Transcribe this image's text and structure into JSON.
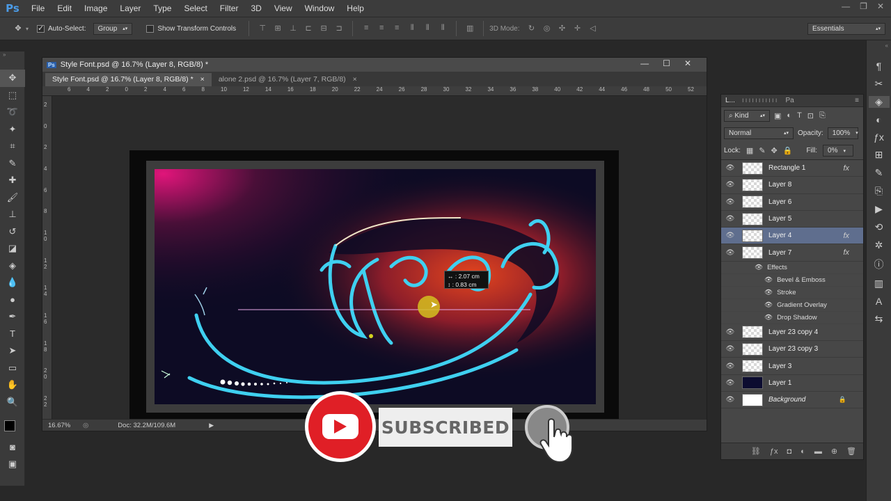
{
  "app": {
    "logo": "Ps"
  },
  "menu": [
    "File",
    "Edit",
    "Image",
    "Layer",
    "Type",
    "Select",
    "Filter",
    "3D",
    "View",
    "Window",
    "Help"
  ],
  "options": {
    "auto_select": "Auto-Select:",
    "group": "Group",
    "transform_controls": "Show Transform Controls",
    "mode_3d": "3D Mode:",
    "workspace": "Essentials"
  },
  "document": {
    "title": "Style Font.psd @ 16.7% (Layer 8, RGB/8) *",
    "tabs": [
      {
        "label": "Style Font.psd @ 16.7% (Layer 8, RGB/8) *",
        "close": "×"
      },
      {
        "label": "alone 2.psd @ 16.7% (Layer 7, RGB/8)",
        "close": "×"
      }
    ],
    "ruler_top": [
      "6",
      "4",
      "2",
      "0",
      "2",
      "4",
      "6",
      "8",
      "10",
      "12",
      "14",
      "16",
      "18",
      "20",
      "22",
      "24",
      "26",
      "28",
      "30",
      "32",
      "34",
      "36",
      "38",
      "40",
      "42",
      "44",
      "46",
      "48",
      "50",
      "52"
    ],
    "ruler_left": [
      "2",
      "0",
      "2",
      "4",
      "6",
      "8",
      "1 0",
      "1 2",
      "1 4",
      "1 6",
      "1 8",
      "2 0",
      "2 2"
    ],
    "zoom": "16.67%",
    "doc_size": "Doc: 32.2M/109.6M",
    "measure_w": "2.07 cm",
    "measure_h": "0.83 cm"
  },
  "layers_panel": {
    "tab": "L...",
    "tab2": "Pa",
    "kind": "Kind",
    "blend": "Normal",
    "opacity_label": "Opacity:",
    "opacity": "100%",
    "lock_label": "Lock:",
    "fill_label": "Fill:",
    "fill": "0%",
    "fx": "fx",
    "layers": [
      {
        "name": "Rectangle 1",
        "fx": true
      },
      {
        "name": "Layer 8"
      },
      {
        "name": "Layer 6"
      },
      {
        "name": "Layer 5"
      },
      {
        "name": "Layer 4",
        "fx": true,
        "selected": true
      },
      {
        "name": "Layer 7",
        "fx": true
      }
    ],
    "effects_label": "Effects",
    "effects": [
      "Bevel & Emboss",
      "Stroke",
      "Gradient Overlay",
      "Drop Shadow"
    ],
    "layers_after": [
      {
        "name": "Layer 23 copy 4"
      },
      {
        "name": "Layer 23 copy 3"
      },
      {
        "name": "Layer 3"
      },
      {
        "name": "Layer 1"
      },
      {
        "name": "Background",
        "locked": true
      }
    ]
  },
  "overlay": {
    "subscribed": "SUBSCRIBED"
  },
  "colors": {
    "accent": "#e01f26",
    "selection": "#5f6e8e",
    "glow": "#3fd0f0"
  }
}
